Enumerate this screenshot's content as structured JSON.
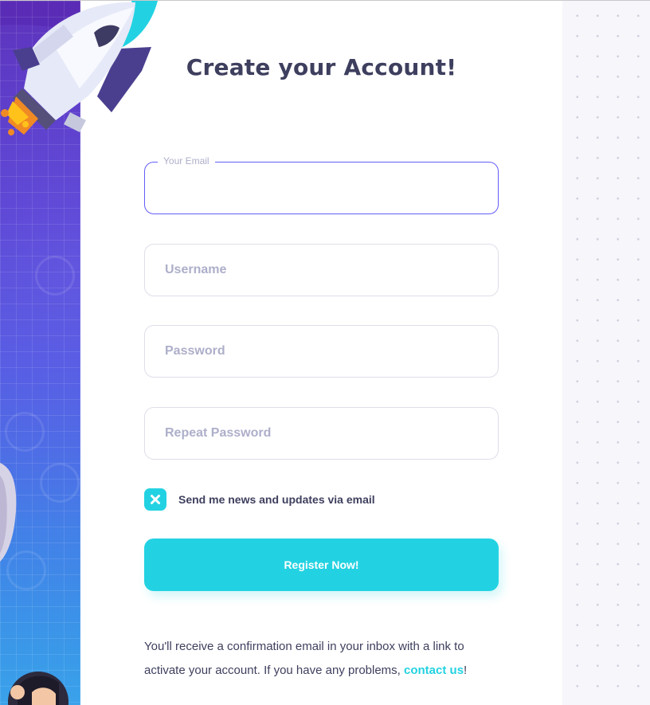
{
  "page": {
    "title": "Create your Account!"
  },
  "form": {
    "email": {
      "label": "Your Email",
      "value": "",
      "placeholder": ""
    },
    "username": {
      "placeholder": "Username",
      "value": ""
    },
    "password": {
      "placeholder": "Password",
      "value": ""
    },
    "repeat_password": {
      "placeholder": "Repeat Password",
      "value": ""
    },
    "newsletter": {
      "label": "Send me news and updates via email",
      "checked": true
    },
    "submit_label": "Register Now!"
  },
  "note": {
    "text_before": "You'll receive a confirmation email in your inbox with a link to activate your account. If you have any problems, ",
    "link_text": "contact us",
    "text_after": "!"
  },
  "colors": {
    "accent": "#23d2e2",
    "focus_border": "#615dfa",
    "text_dark": "#3e3f5e",
    "placeholder": "#adafca"
  }
}
